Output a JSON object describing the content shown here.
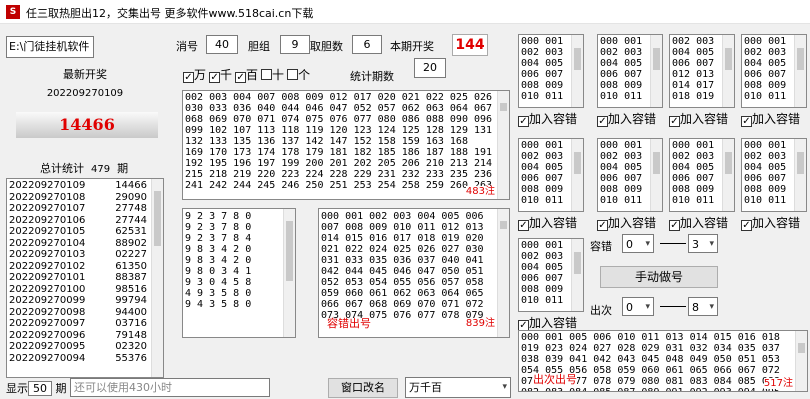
{
  "window": {
    "title": "任三取热胆出12，交集出号 更多软件www.518cai.cn下载"
  },
  "left": {
    "path": "E:\\门徒挂机软件",
    "latest_label": "最新开奖",
    "latest_issue": "202209270109",
    "latest_number": "14466",
    "total_label": "总计统计",
    "total_count": "479",
    "total_unit": "期",
    "history": [
      [
        "202209270109",
        "14466"
      ],
      [
        "202209270108",
        "29090"
      ],
      [
        "202209270107",
        "27748"
      ],
      [
        "202209270106",
        "27744"
      ],
      [
        "202209270105",
        "62531"
      ],
      [
        "202209270104",
        "88902"
      ],
      [
        "202209270103",
        "02227"
      ],
      [
        "202209270102",
        "61350"
      ],
      [
        "202209270101",
        "88387"
      ],
      [
        "202209270100",
        "98516"
      ],
      [
        "202209270099",
        "99794"
      ],
      [
        "202209270098",
        "94400"
      ],
      [
        "202209270097",
        "03716"
      ],
      [
        "202209270096",
        "79148"
      ],
      [
        "202209270095",
        "02320"
      ],
      [
        "202209270094",
        "55376"
      ]
    ],
    "show_label": "显示",
    "show_value": "50",
    "show_unit": "期",
    "status_text": "还可以使用430小时"
  },
  "params": {
    "xiaohao_label": "消号",
    "xiaohao_value": "40",
    "danzu_label": "胆组",
    "danzu_value": "9",
    "qudan_label": "取胆数",
    "qudan_value": "6",
    "bench_label": "本期开奖",
    "bench_value": "144",
    "positions": [
      {
        "label": "万",
        "checked": true
      },
      {
        "label": "千",
        "checked": true
      },
      {
        "label": "百",
        "checked": true
      },
      {
        "label": "十",
        "checked": false
      },
      {
        "label": "个",
        "checked": false
      }
    ],
    "stat_label": "统计期数",
    "stat_value": "20"
  },
  "main_list": {
    "lines": [
      "002 003 004 007 008 009 012 017 020 021 022 025 026",
      "030 033 036 040 044 046 047 052 057 062 063 064 067",
      "068 069 070 071 074 075 076 077 080 086 088 090 096",
      "099 102 107 113 118 119 120 123 124 125 128 129 131",
      "132 133 135 136 137 142 147 152 158 159 163 168",
      "169 170 173 174 178 179 181 182 185 186 187 188 191",
      "192 195 196 197 199 200 201 202 205 206 210 213 214",
      "215 218 219 220 223 224 228 229 231 232 233 235 236",
      "241 242 244 245 246 250 251 253 254 258 259 260 263"
    ],
    "count": "483注"
  },
  "dan_list": {
    "lines": [
      "9 2 3 7 8 0",
      "9 2 3 7 8 0",
      "9 2 3 7 8 4",
      "9 8 3 4 2 0",
      "9 8 3 4 2 0",
      "9 8 0 3 4 1",
      "9 3 0 4 5 8",
      "4 9 3 5 8 0",
      "9 4 3 5 8 0"
    ]
  },
  "rongcuo_list": {
    "lines": [
      "000 001 002 003 004 005 006",
      "007 008 009 010 011 012 013",
      "014 015 016 017 018 019 020",
      "021 022 024 025 026 027 030",
      "031 033 035 036 037 040 041",
      "042 044 045 046 047 050 051",
      "052 053 054 055 056 057 058",
      "059 060 061 062 063 064 065",
      "066 067 068 069 070 071 072",
      "073 074 075 076 077 078 079"
    ],
    "tag": "容错出号",
    "count": "839注"
  },
  "groups": {
    "row1": [
      [
        "000 001",
        "002 003",
        "004 005",
        "006 007",
        "008 009",
        "010 011"
      ],
      [
        "000 001",
        "002 003",
        "004 005",
        "006 007",
        "008 009",
        "010 011"
      ],
      [
        "002 003",
        "004 005",
        "006 007",
        "012 013",
        "014 017",
        "018 019"
      ],
      [
        "000 001",
        "002 003",
        "004 005",
        "006 007",
        "008 009",
        "010 011"
      ]
    ],
    "row2": [
      [
        "000 001",
        "002 003",
        "004 005",
        "006 007",
        "008 009",
        "010 011"
      ],
      [
        "000 001",
        "002 003",
        "004 005",
        "006 007",
        "008 009",
        "010 011"
      ],
      [
        "000 001",
        "002 003",
        "004 005",
        "006 007",
        "008 009",
        "010 011"
      ],
      [
        "000 001",
        "002 003",
        "004 005",
        "006 007",
        "008 009",
        "010 011"
      ]
    ],
    "row3": [
      "000 001",
      "002 003",
      "004 005",
      "006 007",
      "008 009",
      "010 011"
    ],
    "add_label": "加入容错"
  },
  "controls": {
    "rongcuo_label": "容错",
    "rongcuo_from": "0",
    "rongcuo_to": "3",
    "manual_button": "手动做号",
    "chuci_label": "出次",
    "chuci_from": "0",
    "chuci_to": "8"
  },
  "chuci_list": {
    "lines": [
      "000 001 005 006 010 011 013 014 015 016 018",
      "019 023 024 027 028 029 031 032 034 035 037",
      "038 039 041 042 043 045 048 049 050 051 053",
      "054 055 056 058 059 060 061 065 066 067 072",
      "075 076 077 078 079 080 081 083 084 085 088",
      "082 083 084 085 087 089 091 092 093 094 095"
    ],
    "tag": "出次出号",
    "count": "517注"
  },
  "bottom": {
    "rename_button": "窗口改名",
    "mode_value": "万千百"
  },
  "colors": {
    "red": "#e00000",
    "bg": "#f0f0f0"
  }
}
